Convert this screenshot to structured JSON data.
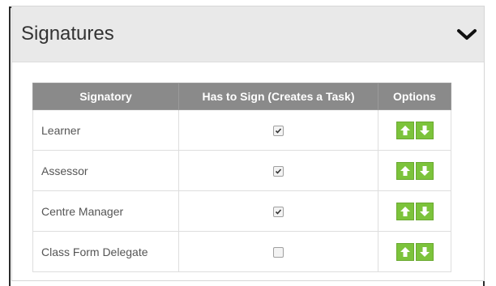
{
  "panel": {
    "title": "Signatures"
  },
  "table": {
    "headers": [
      "Signatory",
      "Has to Sign (Creates a Task)",
      "Options"
    ],
    "rows": [
      {
        "signatory": "Learner",
        "has_to_sign": true
      },
      {
        "signatory": "Assessor",
        "has_to_sign": true
      },
      {
        "signatory": "Centre Manager",
        "has_to_sign": true
      },
      {
        "signatory": "Class Form Delegate",
        "has_to_sign": false
      }
    ]
  },
  "icons": {
    "collapse": "chevron-down-icon",
    "move_up": "arrow-up-icon",
    "move_down": "arrow-down-icon",
    "checked": "checkmark-icon"
  },
  "colors": {
    "header_bg": "#e9e9e9",
    "table_header_bg": "#8a8a8a",
    "option_button": "#7cc33b"
  }
}
